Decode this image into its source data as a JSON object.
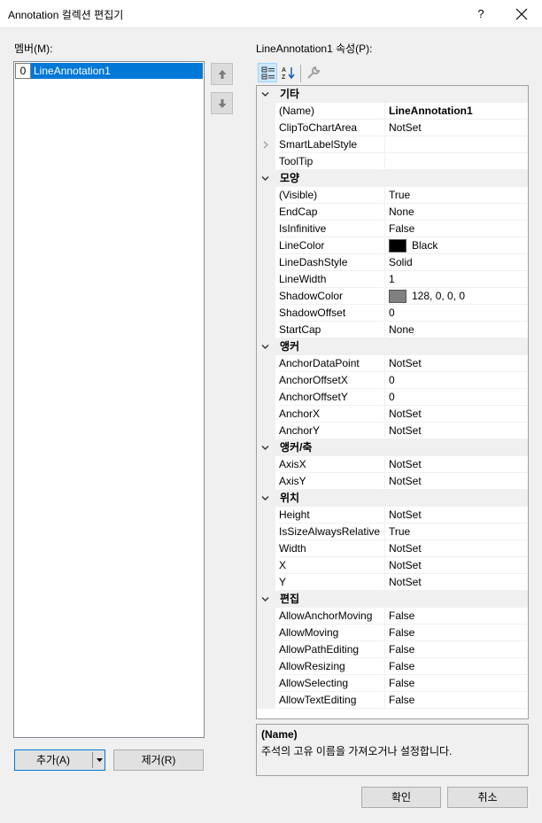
{
  "window": {
    "title": "Annotation 컬렉션 편집기",
    "help": "?"
  },
  "members": {
    "label": "멤버(M):",
    "items": [
      {
        "index": "0",
        "name": "LineAnnotation1"
      }
    ]
  },
  "properties": {
    "label": "LineAnnotation1 속성(P):",
    "categories": [
      {
        "name": "기타",
        "rows": [
          {
            "name": "(Name)",
            "value": "LineAnnotation1"
          },
          {
            "name": "ClipToChartArea",
            "value": "NotSet"
          },
          {
            "name": "SmartLabelStyle",
            "value": ""
          },
          {
            "name": "ToolTip",
            "value": ""
          }
        ]
      },
      {
        "name": "모양",
        "rows": [
          {
            "name": "(Visible)",
            "value": "True"
          },
          {
            "name": "EndCap",
            "value": "None"
          },
          {
            "name": "IsInfinitive",
            "value": "False"
          },
          {
            "name": "LineColor",
            "value": "Black",
            "swatch": "#000000"
          },
          {
            "name": "LineDashStyle",
            "value": "Solid"
          },
          {
            "name": "LineWidth",
            "value": "1"
          },
          {
            "name": "ShadowColor",
            "value": "128, 0, 0, 0",
            "swatch": "#808080"
          },
          {
            "name": "ShadowOffset",
            "value": "0"
          },
          {
            "name": "StartCap",
            "value": "None"
          }
        ]
      },
      {
        "name": "앵커",
        "rows": [
          {
            "name": "AnchorDataPoint",
            "value": "NotSet"
          },
          {
            "name": "AnchorOffsetX",
            "value": "0"
          },
          {
            "name": "AnchorOffsetY",
            "value": "0"
          },
          {
            "name": "AnchorX",
            "value": "NotSet"
          },
          {
            "name": "AnchorY",
            "value": "NotSet"
          }
        ]
      },
      {
        "name": "앵커/축",
        "rows": [
          {
            "name": "AxisX",
            "value": "NotSet"
          },
          {
            "name": "AxisY",
            "value": "NotSet"
          }
        ]
      },
      {
        "name": "위치",
        "rows": [
          {
            "name": "Height",
            "value": "NotSet"
          },
          {
            "name": "IsSizeAlwaysRelative",
            "value": "True"
          },
          {
            "name": "Width",
            "value": "NotSet"
          },
          {
            "name": "X",
            "value": "NotSet"
          },
          {
            "name": "Y",
            "value": "NotSet"
          }
        ]
      },
      {
        "name": "편집",
        "rows": [
          {
            "name": "AllowAnchorMoving",
            "value": "False"
          },
          {
            "name": "AllowMoving",
            "value": "False"
          },
          {
            "name": "AllowPathEditing",
            "value": "False"
          },
          {
            "name": "AllowResizing",
            "value": "False"
          },
          {
            "name": "AllowSelecting",
            "value": "False"
          },
          {
            "name": "AllowTextEditing",
            "value": "False"
          }
        ]
      }
    ]
  },
  "description": {
    "title": "(Name)",
    "text": "주석의 고유 이름을 가져오거나 설정합니다."
  },
  "buttons": {
    "add": "추가(A)",
    "remove": "제거(R)",
    "ok": "확인",
    "cancel": "취소"
  },
  "colors": {
    "selection": "#0078d7",
    "category_bg": "#f0f0f0"
  }
}
